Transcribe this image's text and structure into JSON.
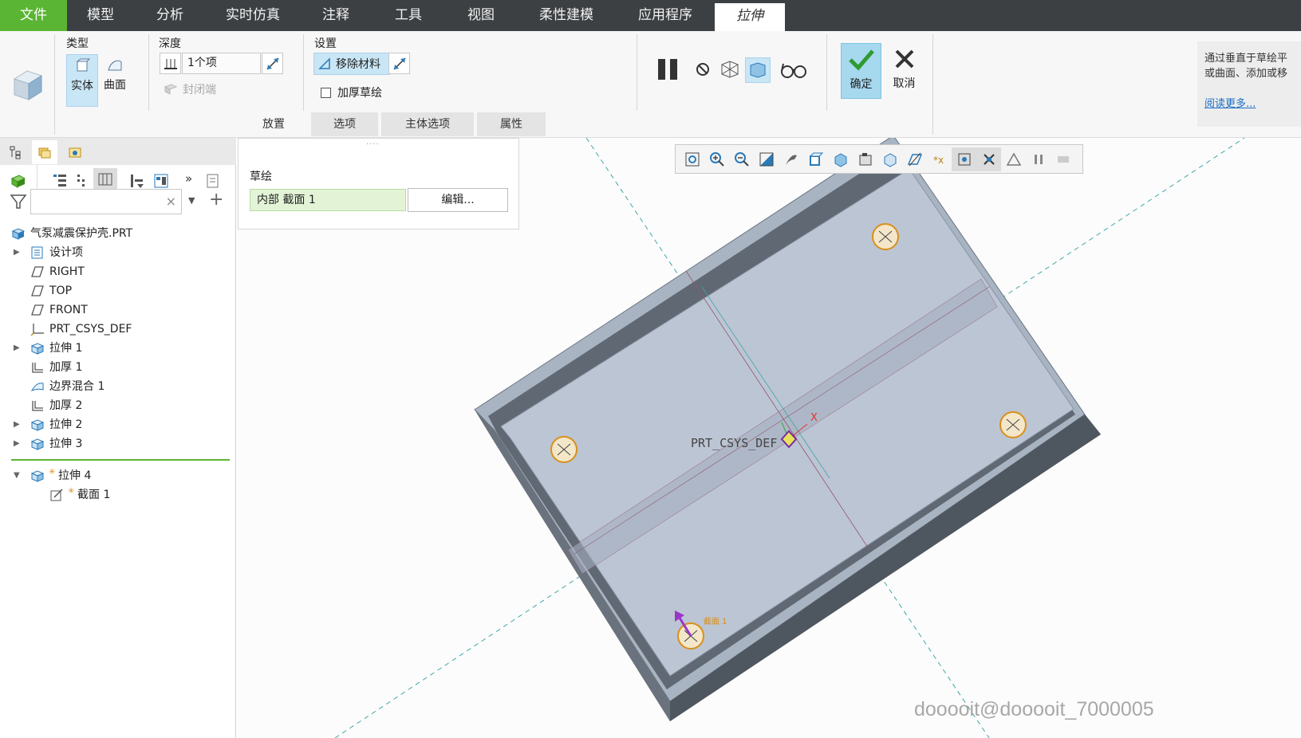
{
  "menubar": {
    "file": "文件",
    "items": [
      "模型",
      "分析",
      "实时仿真",
      "注释",
      "工具",
      "视图",
      "柔性建模",
      "应用程序"
    ],
    "active_tab": "拉伸"
  },
  "ribbon": {
    "type_group": {
      "label": "类型",
      "solid": "实体",
      "surface": "曲面"
    },
    "depth_group": {
      "label": "深度",
      "value": "1个项",
      "cap_ends": "封闭端"
    },
    "settings_group": {
      "label": "设置",
      "remove_material": "移除材料",
      "thicken_sketch": "加厚草绘"
    },
    "ok_label": "确定",
    "cancel_label": "取消",
    "sub_tabs": [
      "放置",
      "选项",
      "主体选项",
      "属性"
    ]
  },
  "help": {
    "line1": "通过垂直于草绘平",
    "line2": "或曲面、添加或移",
    "link": "阅读更多..."
  },
  "placement_panel": {
    "sketch_label": "草绘",
    "sketch_value": "内部 截面 1",
    "edit_button": "编辑..."
  },
  "model_tree": {
    "filter_clear": "×",
    "items": [
      {
        "label": "气泵减震保护壳.PRT",
        "icon": "part-icon",
        "expand": ""
      },
      {
        "label": "设计项",
        "icon": "design-items-icon",
        "expand": "▶"
      },
      {
        "label": "RIGHT",
        "icon": "datum-plane-icon",
        "expand": ""
      },
      {
        "label": "TOP",
        "icon": "datum-plane-icon",
        "expand": ""
      },
      {
        "label": "FRONT",
        "icon": "datum-plane-icon",
        "expand": ""
      },
      {
        "label": "PRT_CSYS_DEF",
        "icon": "csys-icon",
        "expand": ""
      },
      {
        "label": "拉伸 1",
        "icon": "extrude-icon",
        "expand": "▶"
      },
      {
        "label": "加厚 1",
        "icon": "thicken-icon",
        "expand": ""
      },
      {
        "label": "边界混合 1",
        "icon": "boundary-blend-icon",
        "expand": ""
      },
      {
        "label": "加厚 2",
        "icon": "thicken-icon",
        "expand": ""
      },
      {
        "label": "拉伸 2",
        "icon": "extrude-icon",
        "expand": "▶"
      },
      {
        "label": "拉伸 3",
        "icon": "extrude-icon",
        "expand": "▶"
      }
    ],
    "active_feature": {
      "label": "拉伸 4",
      "expand": "▼"
    },
    "active_child": {
      "label": "截面 1"
    }
  },
  "viewport": {
    "csys_label": "PRT_CSYS_DEF",
    "axis_x": "X",
    "section_tag": "截面 1"
  },
  "watermark": "dooooit@dooooit_7000005",
  "colors": {
    "accent_green": "#5bb534",
    "menubar": "#3c4043",
    "part_face": "#bcc5d4",
    "part_side": "#555d66",
    "ok_bg": "#a6d8ee"
  }
}
